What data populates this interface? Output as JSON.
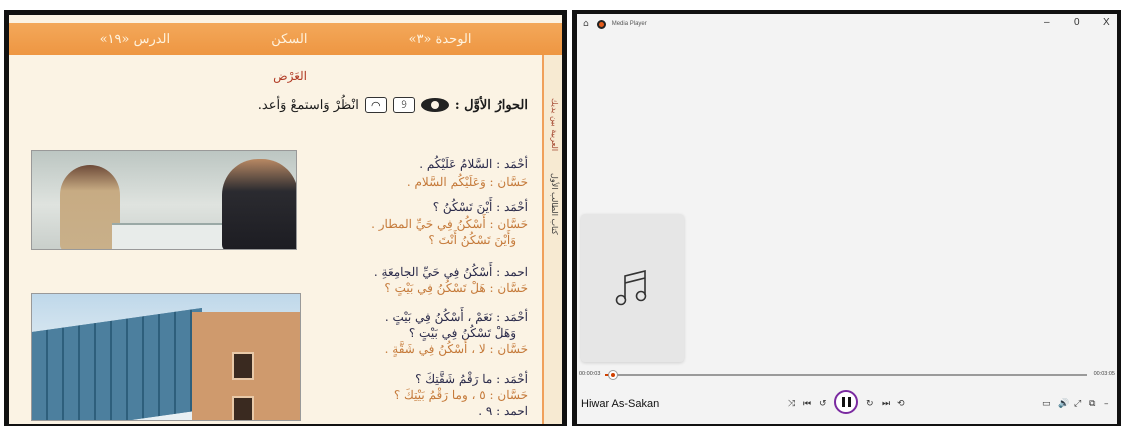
{
  "book": {
    "header": {
      "unit": "الوحدة «٣»",
      "topic": "السكن",
      "lesson": "الدرس «١٩»"
    },
    "side_tab": [
      "العربية بين يديك",
      "كتاب الطالب الأول"
    ],
    "section_title": "العَرْض",
    "dialog_label": "الحوارُ الأوَّل :",
    "dialog_instruction": "انْظُرْ وَاستمعْ وَأعد.",
    "lines": [
      {
        "speaker": "a",
        "text": "أحْمَد : السَّلامُ عَلَيْكُم ."
      },
      {
        "speaker": "b",
        "text": "حَسَّان : وَعَلَيْكُم السَّلام ."
      },
      {
        "speaker": "a",
        "text": "أحْمَد : أَيْنَ تَسْكُنُ ؟"
      },
      {
        "speaker": "b",
        "text": "حَسَّان : أَسْكُنُ فِي حَيِّ المطار ."
      },
      {
        "speaker": "b",
        "text": "وَأَيْنَ تَسْكُنُ أَنْتَ ؟"
      },
      {
        "speaker": "a",
        "text": "احمد : أَسْكُنُ فِي حَيِّ الجامِعَةِ ."
      },
      {
        "speaker": "b",
        "text": "حَسَّان : هَلْ تَسْكُنُ فِي بَيْتٍ ؟"
      },
      {
        "speaker": "a",
        "text": "أحْمَد : نَعَمْ ، أَسْكُنُ فِي بَيْتٍ ."
      },
      {
        "speaker": "a",
        "text": "وَهَلْ تَسْكُنُ فِي بَيْتٍ ؟"
      },
      {
        "speaker": "b",
        "text": "حَسَّان : لا ، أَسْكُنُ فِي شَقَّةٍ ."
      },
      {
        "speaker": "a",
        "text": "أحْمَد : ما رَقْمُ شَقَّتِكَ ؟"
      },
      {
        "speaker": "b",
        "text": "حَسَّان : ٥ ، وما رَقْمُ بَيْتِكَ ؟"
      },
      {
        "speaker": "a",
        "text": "احمد : ٩ ."
      }
    ]
  },
  "player": {
    "app_title": "Media Player",
    "window_controls": {
      "minimize": "–",
      "maximize": "0",
      "close": "X"
    },
    "track_title": "Hiwar As-Sakan",
    "elapsed": "00:00:03",
    "duration": "00:03:05",
    "progress": 0.016,
    "colors": {
      "accent": "#d04000",
      "play_ring": "#7a2aa0"
    },
    "icons": {
      "shuffle": "⤨",
      "previous": "⏮",
      "rewind": "↺",
      "forward": "↻",
      "next": "⏭",
      "repeat": "⟲",
      "miniplayer": "▭",
      "volume": "🔊",
      "fullscreen": "⤢",
      "cast": "⧉",
      "more": "–"
    }
  }
}
